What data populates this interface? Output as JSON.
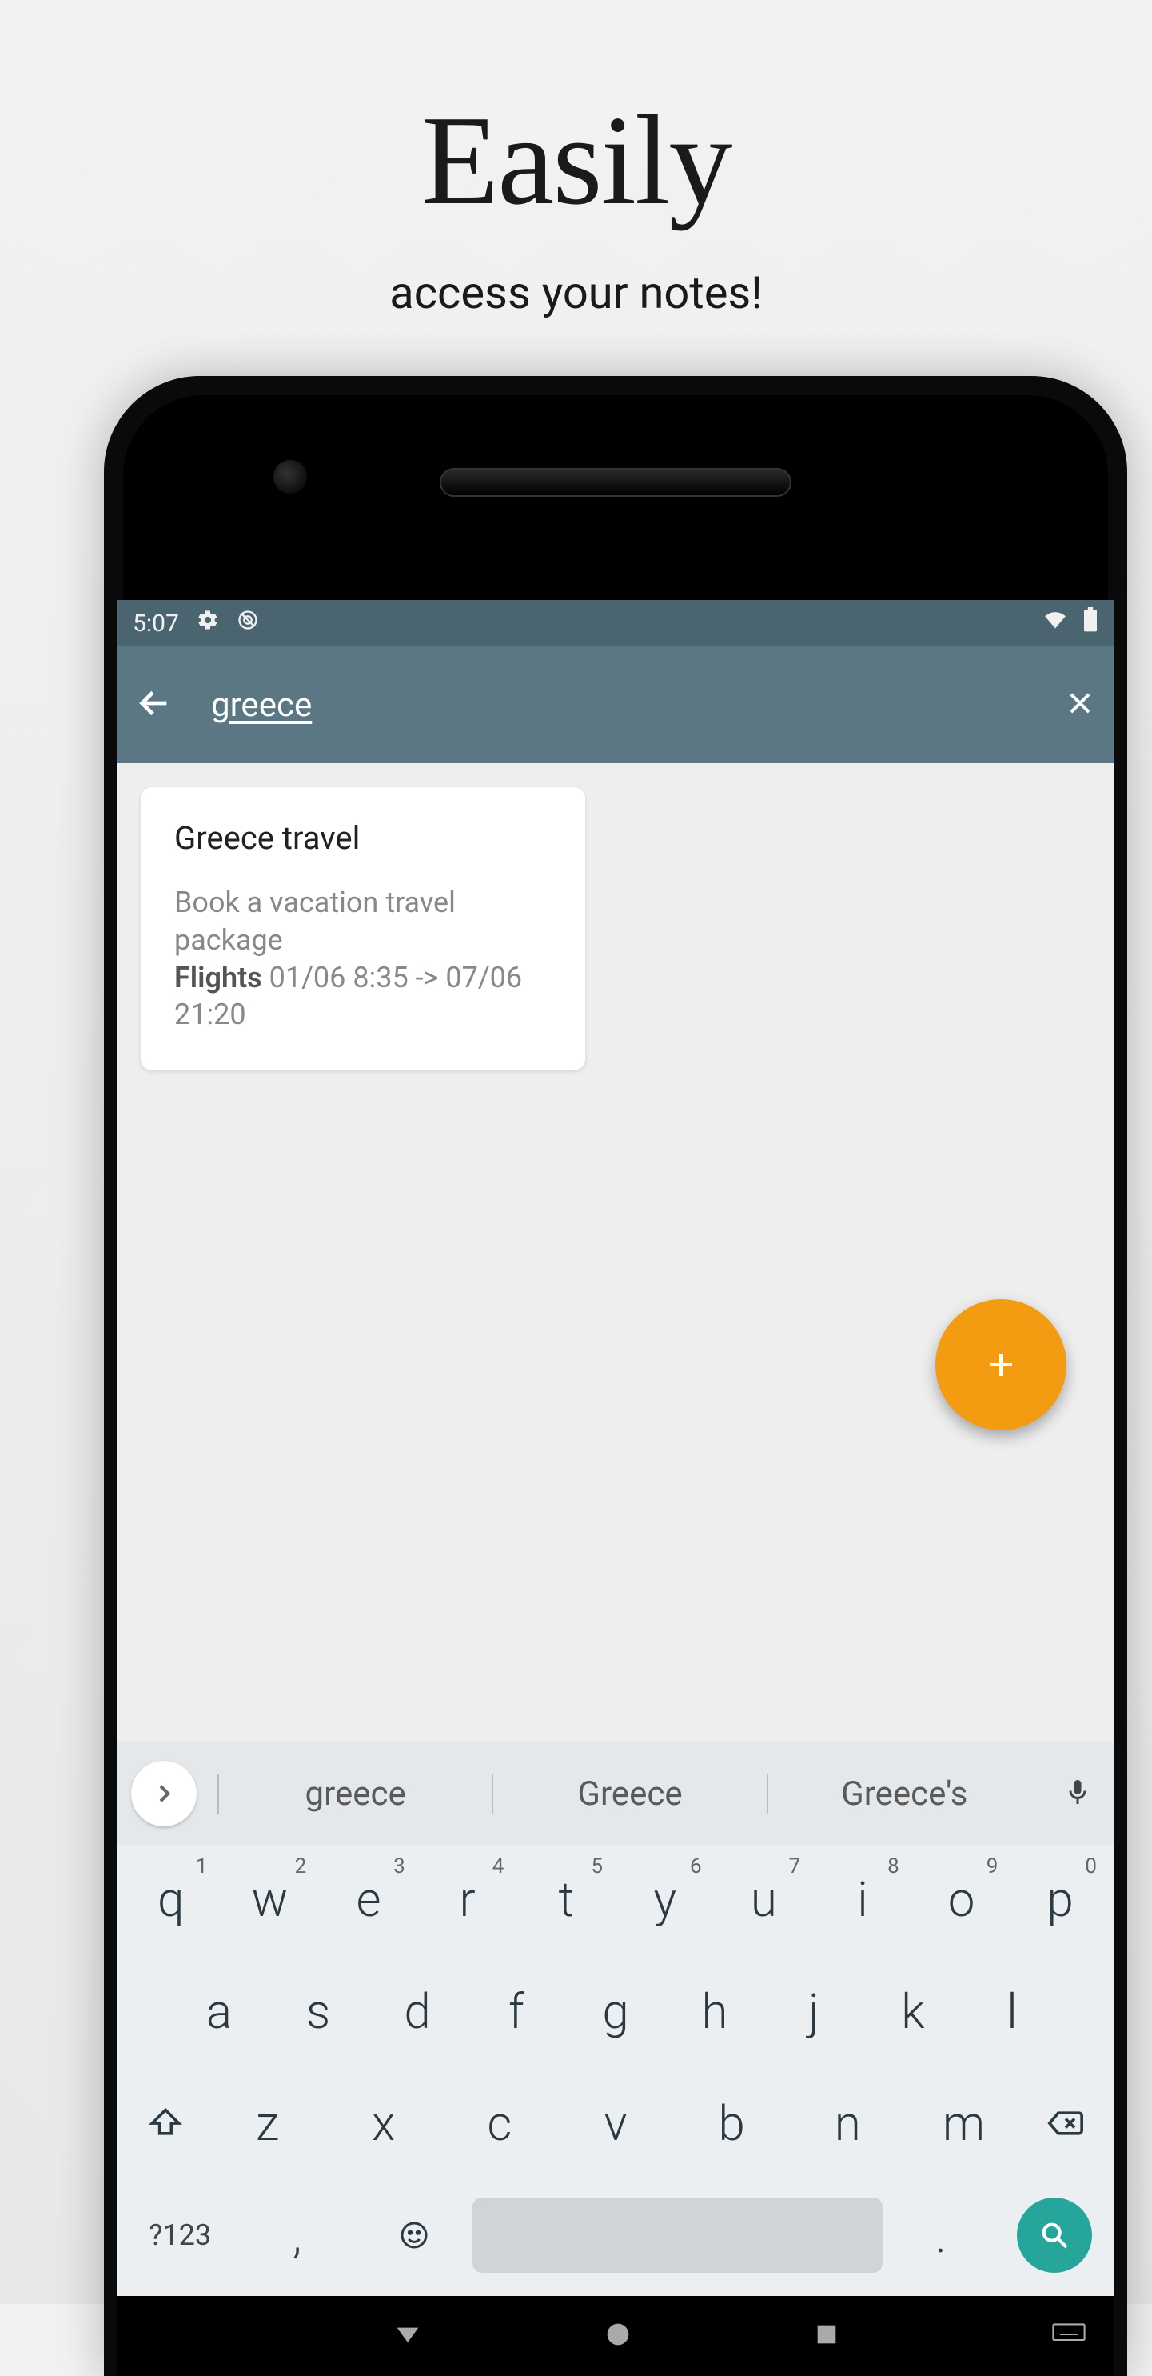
{
  "promo": {
    "headline": "Easily",
    "sub": "access your notes!"
  },
  "statusbar": {
    "time": "5:07"
  },
  "appbar": {
    "search_value": "greece"
  },
  "notes": [
    {
      "title": "Greece travel",
      "body_line1": "Book a vacation travel package",
      "body_strong": "Flights",
      "body_line2": " 01/06 8:35 -> 07/06 21:20"
    }
  ],
  "suggestions": {
    "s1": "greece",
    "s2": "Greece",
    "s3": "Greece's"
  },
  "keyboard": {
    "row1": [
      "q",
      "w",
      "e",
      "r",
      "t",
      "y",
      "u",
      "i",
      "o",
      "p"
    ],
    "row1_sup": [
      "1",
      "2",
      "3",
      "4",
      "5",
      "6",
      "7",
      "8",
      "9",
      "0"
    ],
    "row2": [
      "a",
      "s",
      "d",
      "f",
      "g",
      "h",
      "j",
      "k",
      "l"
    ],
    "row3": [
      "z",
      "x",
      "c",
      "v",
      "b",
      "n",
      "m"
    ],
    "numkey": "?123",
    "comma": ",",
    "period": "."
  },
  "fab_icon": "+"
}
